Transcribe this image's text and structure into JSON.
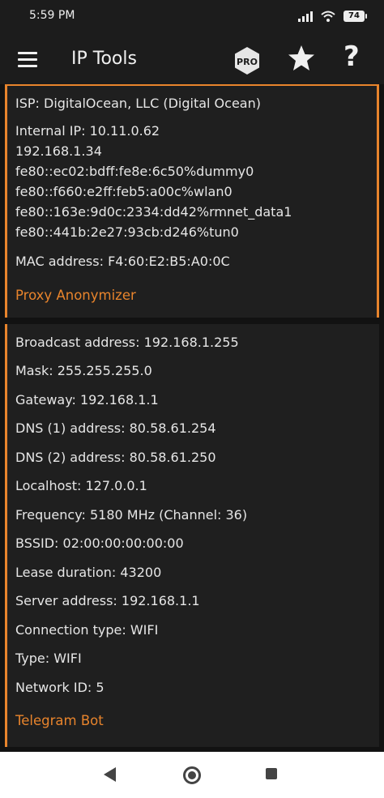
{
  "status": {
    "time": "5:59 PM",
    "battery": "74"
  },
  "app": {
    "title": "IP Tools"
  },
  "card1": {
    "isp": "ISP: DigitalOcean, LLC (Digital Ocean)",
    "internal_ip": "Internal IP: 10.11.0.62",
    "ips": [
      "192.168.1.34",
      "fe80::ec02:bdff:fe8e:6c50%dummy0",
      "fe80::f660:e2ff:feb5:a00c%wlan0",
      "fe80::163e:9d0c:2334:dd42%rmnet_data1",
      "fe80::441b:2e27:93cb:d246%tun0"
    ],
    "mac": "MAC address: F4:60:E2:B5:A0:0C",
    "link": "Proxy Anonymizer"
  },
  "card2": {
    "lines": [
      "Broadcast address: 192.168.1.255",
      "Mask: 255.255.255.0",
      "Gateway: 192.168.1.1",
      "DNS (1) address: 80.58.61.254",
      "DNS (2) address: 80.58.61.250",
      "Localhost: 127.0.0.1",
      "Frequency: 5180 MHz (Channel: 36)",
      "BSSID: 02:00:00:00:00:00",
      "Lease duration: 43200",
      "Server address: 192.168.1.1",
      "Connection type: WIFI",
      "Type: WIFI",
      "Network ID: 5"
    ],
    "link": "Telegram Bot"
  }
}
